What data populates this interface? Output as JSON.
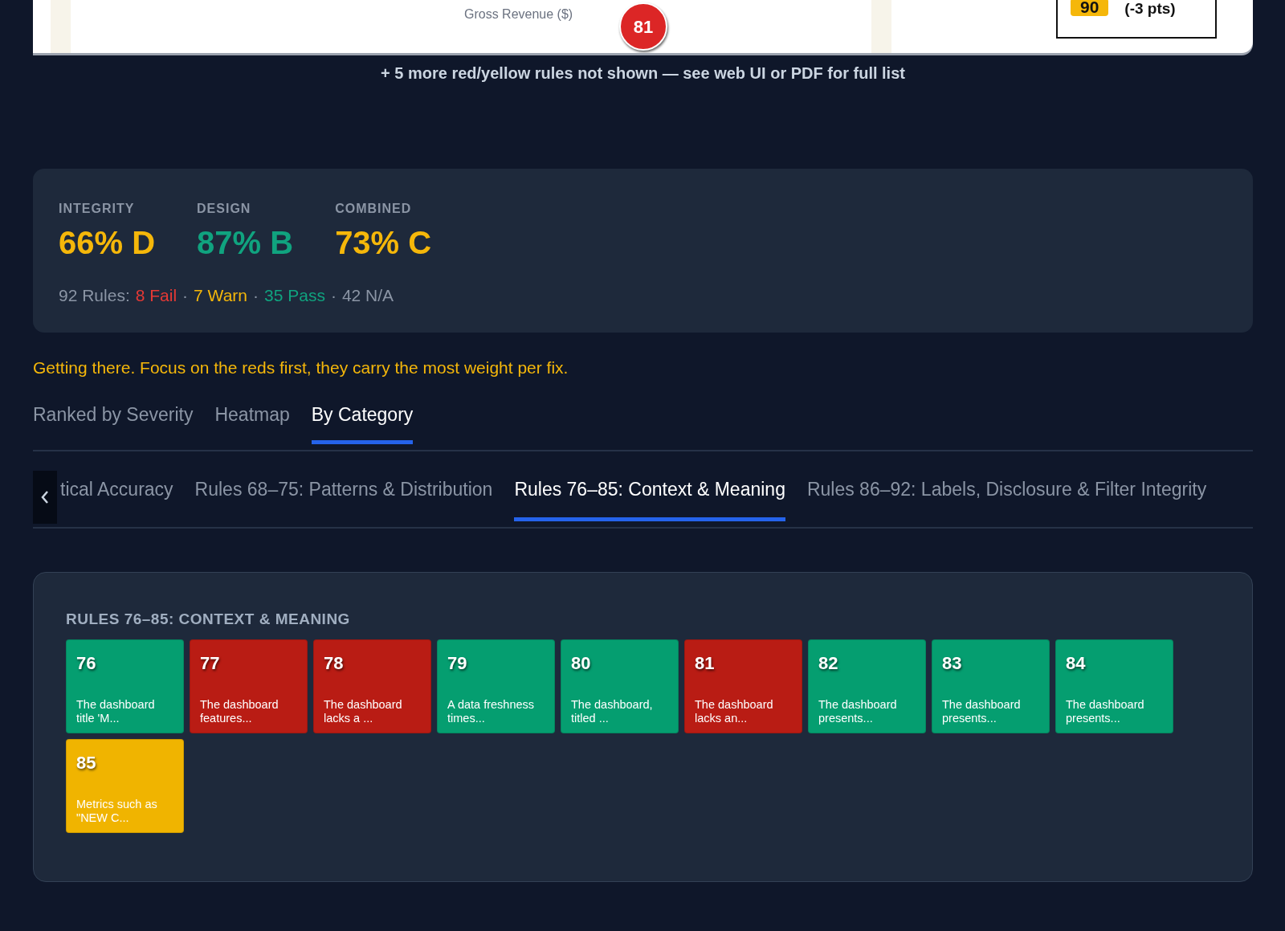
{
  "preview": {
    "axis_label": "Gross Revenue ($)",
    "marker": "81",
    "score_badge": "90",
    "score_delta": "(-3 pts)"
  },
  "more_note": "+ 5 more red/yellow rules not shown — see web UI or PDF for full list",
  "scores": [
    {
      "label": "INTEGRITY",
      "value": "66% D",
      "color": "#f5b70a"
    },
    {
      "label": "DESIGN",
      "value": "87% B",
      "color": "#10a37f"
    },
    {
      "label": "COMBINED",
      "value": "73% C",
      "color": "#f5b70a"
    }
  ],
  "summary": [
    {
      "kind": "count",
      "text": "92 Rules:",
      "color": "#8b95a5"
    },
    {
      "kind": "count",
      "text": "8 Fail",
      "color": "#e53935"
    },
    {
      "kind": "separator",
      "text": "·"
    },
    {
      "kind": "count",
      "text": "7 Warn",
      "color": "#f5b70a"
    },
    {
      "kind": "separator",
      "text": "·"
    },
    {
      "kind": "count",
      "text": "35 Pass",
      "color": "#10a37f"
    },
    {
      "kind": "separator",
      "text": "·"
    },
    {
      "kind": "count",
      "text": "42 N/A",
      "color": "#8b95a5"
    }
  ],
  "message": "Getting there. Focus on the reds first, they carry the most weight per fix.",
  "view_tabs": [
    {
      "label": "Ranked by Severity",
      "selected": false
    },
    {
      "label": "Heatmap",
      "selected": false
    },
    {
      "label": "By Category",
      "selected": true
    }
  ],
  "category_tabs": [
    {
      "label": "tical Accuracy",
      "selected": false
    },
    {
      "label": "Rules 68–75: Patterns & Distribution",
      "selected": false
    },
    {
      "label": "Rules 76–85: Context & Meaning",
      "selected": true
    },
    {
      "label": "Rules 86–92: Labels, Disclosure & Filter Integrity",
      "selected": false
    }
  ],
  "category": {
    "title": "RULES 76–85: CONTEXT & MEANING",
    "rules": [
      {
        "number": "76",
        "text": "The dashboard title 'M...",
        "color": "#059e70"
      },
      {
        "number": "77",
        "text": "The dashboard features...",
        "color": "#b91c14"
      },
      {
        "number": "78",
        "text": "The dashboard lacks a ...",
        "color": "#b91c14"
      },
      {
        "number": "79",
        "text": "A data freshness times...",
        "color": "#059e70"
      },
      {
        "number": "80",
        "text": "The dashboard, titled ...",
        "color": "#059e70"
      },
      {
        "number": "81",
        "text": "The dashboard lacks an...",
        "color": "#b91c14"
      },
      {
        "number": "82",
        "text": "The dashboard presents...",
        "color": "#059e70"
      },
      {
        "number": "83",
        "text": "The dashboard presents...",
        "color": "#059e70"
      },
      {
        "number": "84",
        "text": "The dashboard presents...",
        "color": "#059e70"
      },
      {
        "number": "85",
        "text": "Metrics such as \"NEW C...",
        "color": "#f0b400"
      }
    ]
  }
}
